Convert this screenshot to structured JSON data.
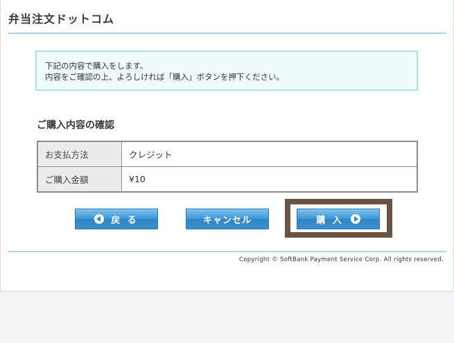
{
  "site": {
    "title": "弁当注文ドットコム"
  },
  "notice": {
    "line1": "下記の内容で購入をします。",
    "line2": "内容をご確認の上、よろしければ「購入」ボタンを押下ください。"
  },
  "confirmation": {
    "title": "ご購入内容の確認",
    "rows": [
      {
        "label": "お支払方法",
        "value": "クレジット"
      },
      {
        "label": "ご購入金額",
        "value": "¥10"
      }
    ]
  },
  "buttons": {
    "back": "戻 る",
    "cancel": "キャンセル",
    "buy": "購 入"
  },
  "footer": {
    "copyright": "Copyright © SoftBank Payment Service Corp. All rights reserved."
  },
  "colors": {
    "accent": "#3f97d6",
    "highlight_frame": "#6b5443",
    "rule": "#a9d5e6"
  }
}
